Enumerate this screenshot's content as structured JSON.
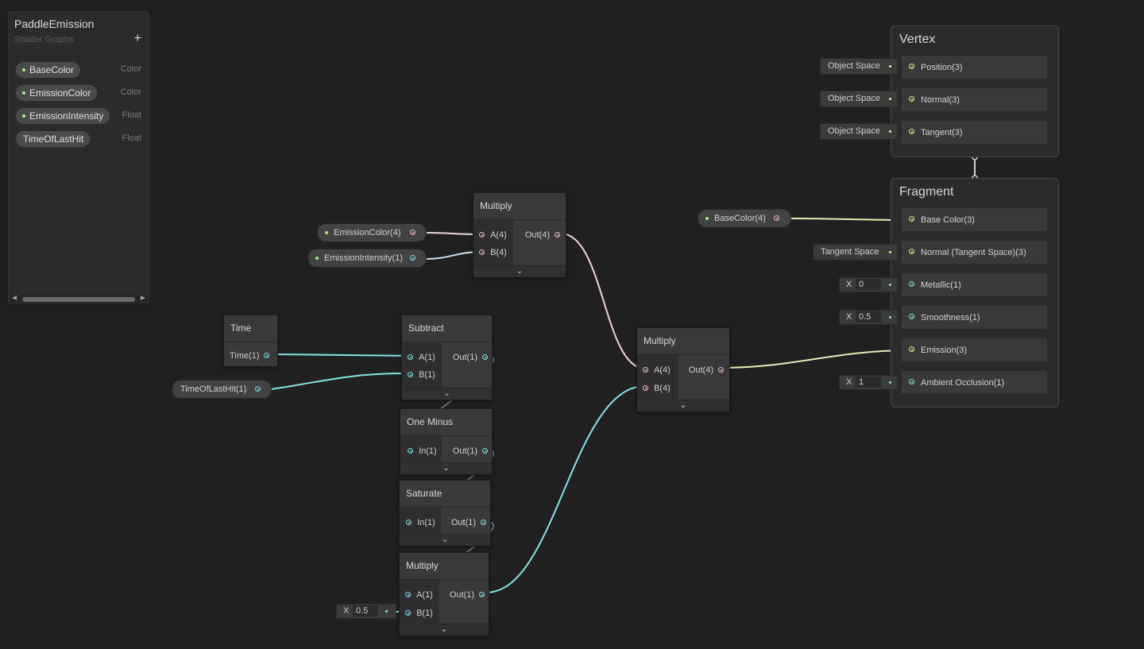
{
  "blackboard": {
    "title": "PaddleEmission",
    "subtitle": "Shader Graphs",
    "add_label": "+",
    "properties": [
      {
        "name": "BaseColor",
        "type": "Color"
      },
      {
        "name": "EmissionColor",
        "type": "Color"
      },
      {
        "name": "EmissionIntensity",
        "type": "Float"
      },
      {
        "name": "TimeOfLastHit",
        "type": "Float"
      }
    ]
  },
  "canvas_props": {
    "emission_color": "EmissionColor(4)",
    "emission_intensity": "EmissionIntensity(1)",
    "time_of_last_hit": "TimeOfLastHit(1)",
    "base_color": "BaseColor(4)"
  },
  "nodes": {
    "multiply_top": {
      "title": "Multiply",
      "in_a": "A(4)",
      "in_b": "B(4)",
      "out": "Out(4)"
    },
    "time": {
      "title": "Time",
      "out": "Time(1)"
    },
    "subtract": {
      "title": "Subtract",
      "in_a": "A(1)",
      "in_b": "B(1)",
      "out": "Out(1)"
    },
    "one_minus": {
      "title": "One Minus",
      "in": "In(1)",
      "out": "Out(1)"
    },
    "saturate": {
      "title": "Saturate",
      "in": "In(1)",
      "out": "Out(1)"
    },
    "multiply_low": {
      "title": "Multiply",
      "in_a": "A(1)",
      "in_b": "B(1)",
      "out": "Out(1)",
      "b_x": "X",
      "b_value": "0.5"
    },
    "multiply_mid": {
      "title": "Multiply",
      "in_a": "A(4)",
      "in_b": "B(4)",
      "out": "Out(4)"
    }
  },
  "vertex": {
    "title": "Vertex",
    "blocks": [
      {
        "label": "Position(3)",
        "field": "Object Space"
      },
      {
        "label": "Normal(3)",
        "field": "Object Space"
      },
      {
        "label": "Tangent(3)",
        "field": "Object Space"
      }
    ]
  },
  "fragment": {
    "title": "Fragment",
    "blocks": [
      {
        "label": "Base Color(3)"
      },
      {
        "label": "Normal (Tangent Space)(3)",
        "field": "Tangent Space"
      },
      {
        "label": "Metallic(1)",
        "x": "X",
        "value": "0"
      },
      {
        "label": "Smoothness(1)",
        "x": "X",
        "value": "0.5"
      },
      {
        "label": "Emission(3)"
      },
      {
        "label": "Ambient Occlusion(1)",
        "x": "X",
        "value": "1"
      }
    ]
  },
  "icons": {
    "expand": "chevron-down-icon",
    "add": "plus-icon"
  },
  "colors": {
    "vector4_port": "#f0b7d6",
    "float_port": "#84e4e7",
    "vector3_port": "#e8ec8a",
    "property_dot": "#a8e68c",
    "canvas": "#202020"
  }
}
